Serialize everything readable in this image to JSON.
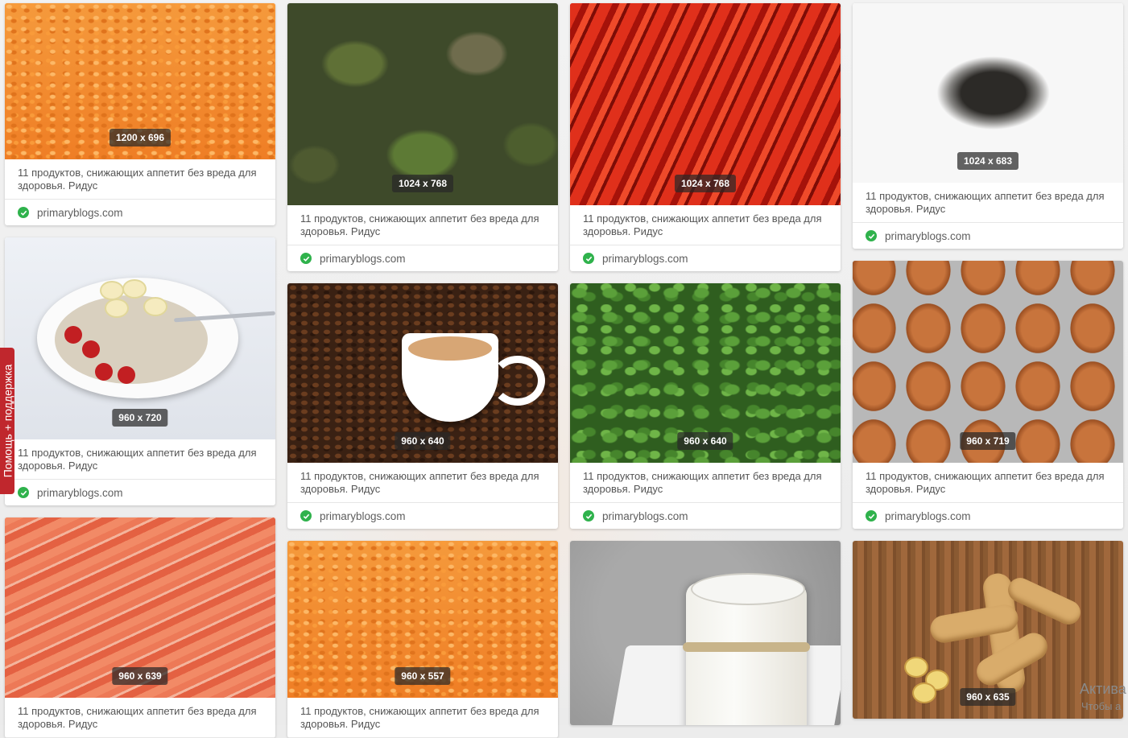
{
  "results": [
    {
      "dims": "1200 x 696",
      "title": "11 продуктов, снижающих аппетит без вреда для здоровья. Ридус",
      "source": "primaryblogs.com"
    },
    {
      "dims": "1024 x 768",
      "title": "11 продуктов, снижающих аппетит без вреда для здоровья. Ридус",
      "source": "primaryblogs.com"
    },
    {
      "dims": "1024 x 768",
      "title": "11 продуктов, снижающих аппетит без вреда для здоровья. Ридус",
      "source": "primaryblogs.com"
    },
    {
      "dims": "1024 x 683",
      "title": "11 продуктов, снижающих аппетит без вреда для здоровья. Ридус",
      "source": "primaryblogs.com"
    },
    {
      "dims": "960 x 720",
      "title": "11 продуктов, снижающих аппетит без вреда для здоровья. Ридус",
      "source": "primaryblogs.com"
    },
    {
      "dims": "960 x 640",
      "title": "11 продуктов, снижающих аппетит без вреда для здоровья. Ридус",
      "source": "primaryblogs.com"
    },
    {
      "dims": "960 x 640",
      "title": "11 продуктов, снижающих аппетит без вреда для здоровья. Ридус",
      "source": "primaryblogs.com"
    },
    {
      "dims": "960 x 719",
      "title": "11 продуктов, снижающих аппетит без вреда для здоровья. Ридус",
      "source": "primaryblogs.com"
    },
    {
      "dims": "960 x 639",
      "title": "11 продуктов, снижающих аппетит без вреда для здоровья. Ридус"
    },
    {
      "dims": "960 x 557",
      "title": "11 продуктов, снижающих аппетит без вреда для здоровья. Ридус"
    },
    {},
    {
      "dims": "960 x 635"
    }
  ],
  "support_tab": "Помощь + поддержка",
  "os_watermark": {
    "line1": "Актива",
    "line2": "Чтобы а"
  },
  "icons": {
    "verified": "check-circle-icon"
  },
  "colors": {
    "verified": "#2fb24c",
    "support": "#c0272d"
  }
}
